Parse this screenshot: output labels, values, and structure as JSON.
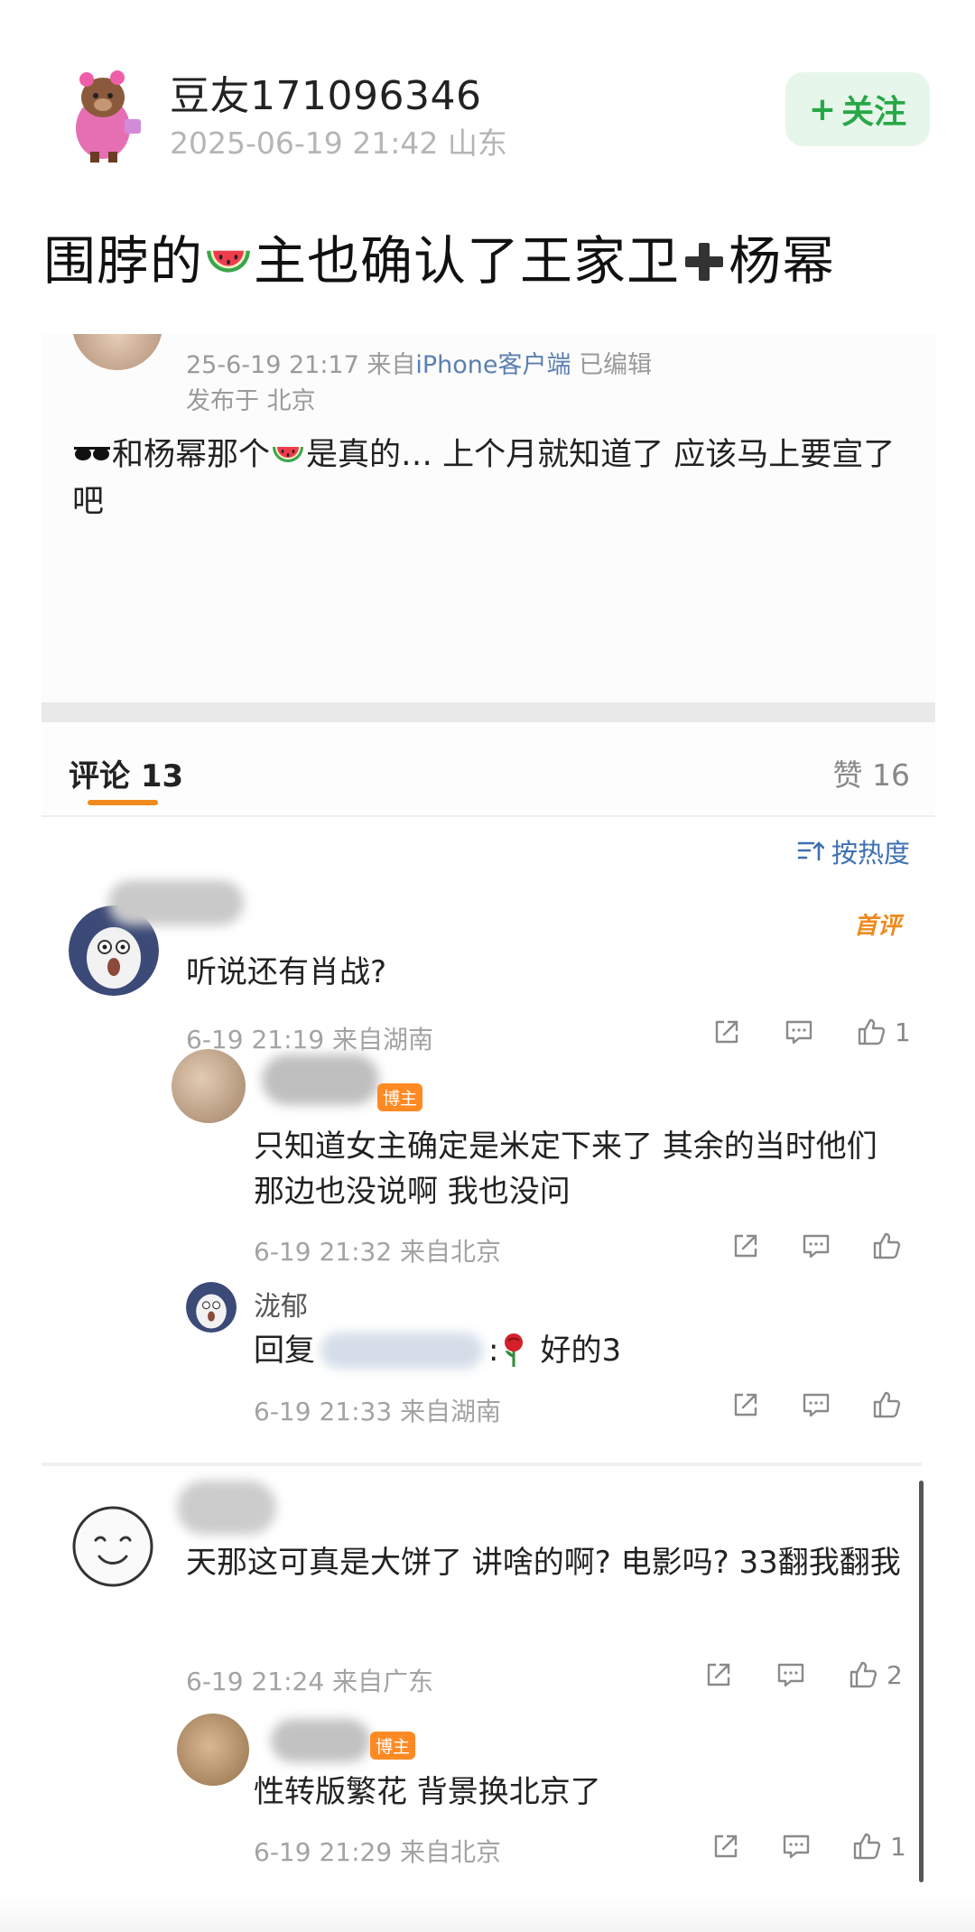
{
  "post": {
    "username": "豆友171096346",
    "meta": "2025-06-19 21:42 山东",
    "follow_label": "关注",
    "follow_plus": "+",
    "headline_part1": "围脖的",
    "headline_part2": "主也确认了王家卫",
    "headline_part3": "杨幂"
  },
  "embed": {
    "meta_time": "25-6-19 21:17",
    "meta_from_prefix": "来自",
    "meta_client": "iPhone客户端",
    "meta_edited": "已编辑",
    "location": "发布于 北京",
    "text_part1": "和杨幂那个",
    "text_part2": "是真的… 上个月就知道了 应该马上要宣了吧"
  },
  "tabs": {
    "comments_label": "评论 13",
    "likes_label": "赞 16",
    "sort_label": "按热度"
  },
  "comments": [
    {
      "first_badge": "首评",
      "text": "听说还有肖战?",
      "meta": "6-19 21:19 来自湖南",
      "likes": "1",
      "replies": [
        {
          "owner_badge": "博主",
          "text": "只知道女主确定是米定下来了  其余的当时他们那边也没说啊 我也没问",
          "meta": "6-19 21:32 来自北京"
        },
        {
          "name": "泷郁",
          "text_prefix": "回复",
          "text_suffix": "好的3",
          "meta": "6-19 21:33 来自湖南"
        }
      ]
    },
    {
      "text": "天那这可真是大饼了 讲啥的啊? 电影吗?  33翻我翻我",
      "meta": "6-19 21:24 来自广东",
      "likes": "2",
      "replies": [
        {
          "owner_badge": "博主",
          "text": "性转版繁花 背景换北京了",
          "meta": "6-19 21:29 来自北京",
          "likes": "1"
        }
      ]
    }
  ],
  "colors": {
    "follow_green": "#27a847",
    "follow_bg": "#e7f6ea",
    "accent_orange": "#f08a1d",
    "link_blue": "#3d6fb3",
    "meta_gray": "#a3a3a3"
  }
}
